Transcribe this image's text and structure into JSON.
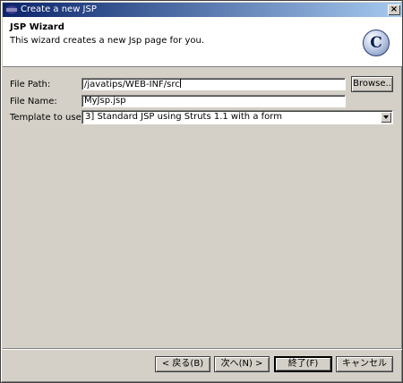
{
  "window": {
    "title": "Create a new JSP",
    "icon": "eclipse-icon",
    "close_label": "×"
  },
  "banner": {
    "title": "JSP Wizard",
    "description": "This wizard creates a new Jsp page for you.",
    "logo_letter": "C"
  },
  "form": {
    "file_path": {
      "label": "File Path:",
      "value": "/javatips/WEB-INF/src",
      "browse_label": "Browse.."
    },
    "file_name": {
      "label": "File Name:",
      "value": "MyJsp.jsp"
    },
    "template": {
      "label": "Template to use:",
      "value": "3] Standard JSP using Struts 1.1 with a form"
    }
  },
  "footer": {
    "back_label": "< 戻る(B)",
    "next_label": "次へ(N) >",
    "finish_label": "終了(F)",
    "cancel_label": "キャンセル"
  },
  "colors": {
    "dialog_bg": "#d4d0c8",
    "titlebar_start": "#0a246a",
    "titlebar_end": "#a6caf0"
  }
}
